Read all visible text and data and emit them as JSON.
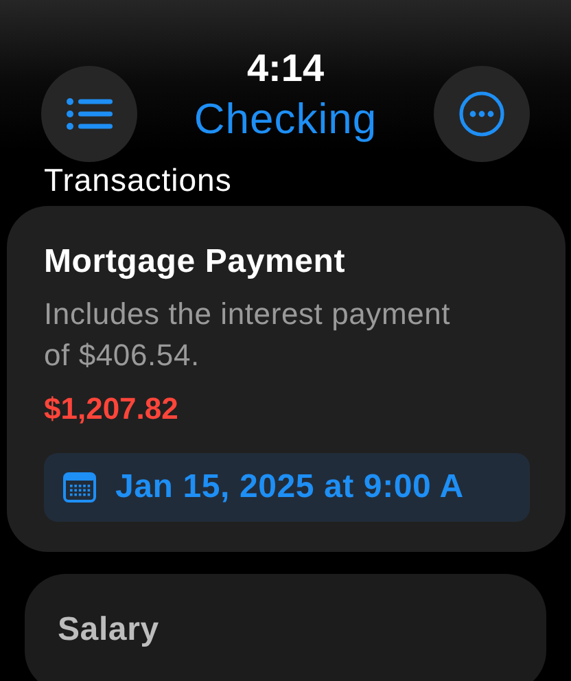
{
  "header": {
    "time": "4:14",
    "title": "Checking"
  },
  "section_title": "Transactions",
  "transactions": [
    {
      "title": "Mortgage Payment",
      "description": "Includes the interest payment of $406.54.",
      "amount": "$1,207.82",
      "date": "Jan 15, 2025 at 9:00 A"
    },
    {
      "title": "Salary"
    }
  ]
}
